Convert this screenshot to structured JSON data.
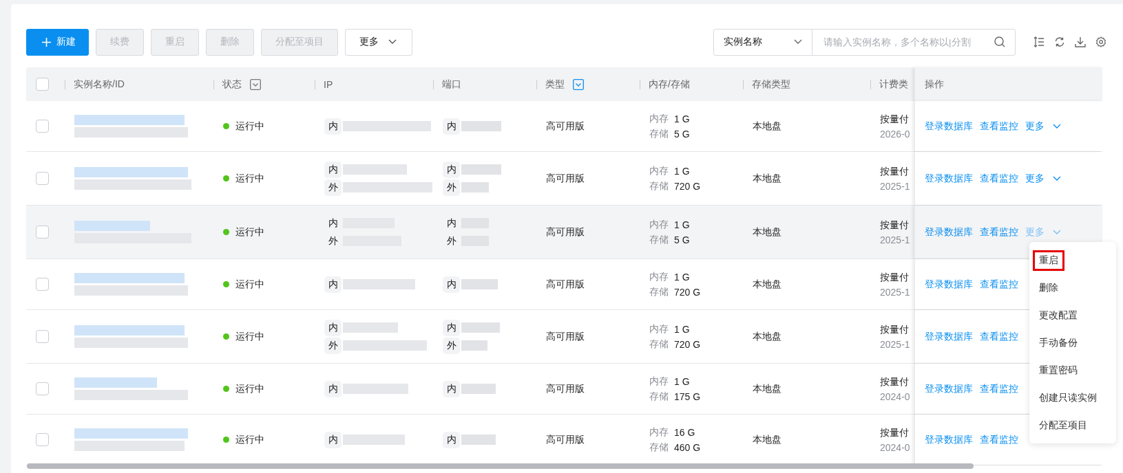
{
  "toolbar": {
    "buttons": [
      {
        "label": "新建",
        "kind": "primary",
        "disabled": false
      },
      {
        "label": "续费",
        "kind": "plain",
        "disabled": true
      },
      {
        "label": "重启",
        "kind": "plain",
        "disabled": true
      },
      {
        "label": "删除",
        "kind": "plain",
        "disabled": true
      },
      {
        "label": "分配至项目",
        "kind": "plain",
        "disabled": true
      },
      {
        "label": "更多",
        "kind": "dropdown",
        "disabled": false
      }
    ],
    "search": {
      "field": "实例名称",
      "placeholder": "请输入实例名称，多个名称以|分割"
    }
  },
  "table": {
    "select_all_checked": false,
    "columns": [
      {
        "label": "实例名称/ID"
      },
      {
        "label": "状态",
        "filter": true,
        "filter_active": false
      },
      {
        "label": "IP"
      },
      {
        "label": "端口"
      },
      {
        "label": "类型",
        "filter": true,
        "filter_active": true
      },
      {
        "label": "内存/存储"
      },
      {
        "label": "存储类型"
      },
      {
        "label": "计费类"
      },
      {
        "label": "操作"
      }
    ],
    "rows": [
      {
        "checked": false,
        "hovered": false,
        "status": "运行中",
        "color": "#52c41a",
        "ip": [
          "内"
        ],
        "port": [
          "内"
        ],
        "type": "高可用版",
        "memory_label": "内存",
        "memory": "1 G",
        "storage_label": "存储",
        "storage": "5 G",
        "storage_type": "本地盘",
        "billing": "按量付",
        "billing_date": "2026-0",
        "actions": [
          "登录数据库",
          "查看监控",
          "更多"
        ]
      },
      {
        "checked": false,
        "hovered": false,
        "status": "运行中",
        "color": "#52c41a",
        "ip": [
          "内",
          "外"
        ],
        "port": [
          "内",
          "外"
        ],
        "type": "高可用版",
        "memory_label": "内存",
        "memory": "1 G",
        "storage_label": "存储",
        "storage": "720 G",
        "storage_type": "本地盘",
        "billing": "按量付",
        "billing_date": "2025-1",
        "actions": [
          "登录数据库",
          "查看监控",
          "更多"
        ]
      },
      {
        "checked": false,
        "hovered": true,
        "status": "运行中",
        "color": "#52c41a",
        "ip": [
          "内",
          "外"
        ],
        "port": [
          "内",
          "外"
        ],
        "type": "高可用版",
        "memory_label": "内存",
        "memory": "1 G",
        "storage_label": "存储",
        "storage": "5 G",
        "storage_type": "本地盘",
        "billing": "按量付",
        "billing_date": "2025-1",
        "actions": [
          "登录数据库",
          "查看监控",
          "更多"
        ]
      },
      {
        "checked": false,
        "hovered": false,
        "status": "运行中",
        "color": "#52c41a",
        "ip": [
          "内"
        ],
        "port": [
          "内"
        ],
        "type": "高可用版",
        "memory_label": "内存",
        "memory": "1 G",
        "storage_label": "存储",
        "storage": "720 G",
        "storage_type": "本地盘",
        "billing": "按量付",
        "billing_date": "2025-1",
        "actions": [
          "登录数据库",
          "查看监控"
        ]
      },
      {
        "checked": false,
        "hovered": false,
        "status": "运行中",
        "color": "#52c41a",
        "ip": [
          "内",
          "外"
        ],
        "port": [
          "内",
          "外"
        ],
        "type": "高可用版",
        "memory_label": "内存",
        "memory": "1 G",
        "storage_label": "存储",
        "storage": "720 G",
        "storage_type": "本地盘",
        "billing": "按量付",
        "billing_date": "2025-1",
        "actions": [
          "登录数据库",
          "查看监控"
        ]
      },
      {
        "checked": false,
        "hovered": false,
        "status": "运行中",
        "color": "#52c41a",
        "ip": [
          "内"
        ],
        "port": [
          "内"
        ],
        "type": "高可用版",
        "memory_label": "内存",
        "memory": "1 G",
        "storage_label": "存储",
        "storage": "175 G",
        "storage_type": "本地盘",
        "billing": "按量付",
        "billing_date": "2024-0",
        "actions": [
          "登录数据库",
          "查看监控"
        ]
      },
      {
        "checked": false,
        "hovered": false,
        "status": "运行中",
        "color": "#52c41a",
        "ip": [
          "内"
        ],
        "port": [
          "内"
        ],
        "type": "高可用版",
        "memory_label": "内存",
        "memory": "16 G",
        "storage_label": "存储",
        "storage": "460 G",
        "storage_type": "本地盘",
        "billing": "按量付",
        "billing_date": "2024-0",
        "actions": [
          "登录数据库",
          "查看监控"
        ]
      }
    ]
  },
  "more_menu": {
    "items": [
      {
        "label": "重启",
        "highlighted": true
      },
      {
        "label": "删除",
        "highlighted": false
      },
      {
        "label": "更改配置",
        "highlighted": false
      },
      {
        "label": "手动备份",
        "highlighted": false
      },
      {
        "label": "重置密码",
        "highlighted": false
      },
      {
        "label": "创建只读实例",
        "highlighted": false
      },
      {
        "label": "分配至项目",
        "highlighted": false
      }
    ]
  }
}
